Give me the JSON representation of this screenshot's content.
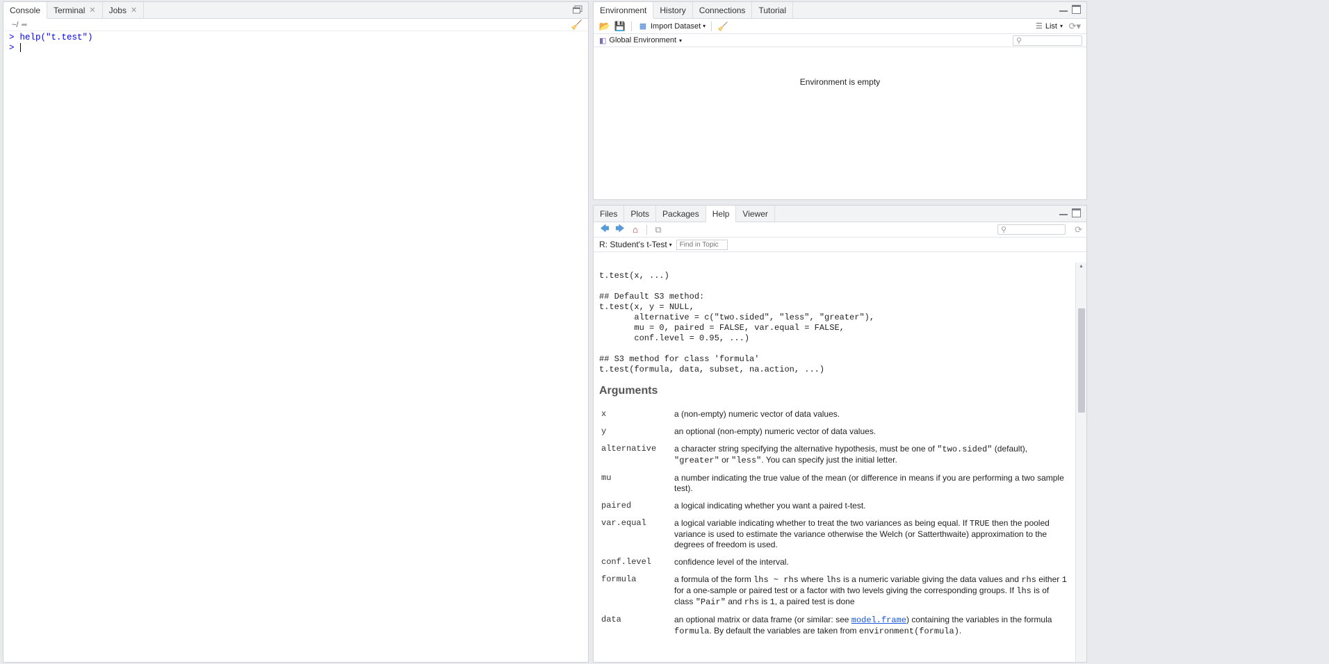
{
  "console_pane": {
    "tabs": [
      {
        "label": "Console",
        "closable": false,
        "active": true
      },
      {
        "label": "Terminal",
        "closable": true,
        "active": false
      },
      {
        "label": "Jobs",
        "closable": true,
        "active": false
      }
    ],
    "path": "~/",
    "lines": [
      {
        "prompt": ">",
        "text": "help(\"t.test\")"
      },
      {
        "prompt": ">",
        "text": ""
      }
    ]
  },
  "env_pane": {
    "tabs": [
      {
        "label": "Environment",
        "active": true
      },
      {
        "label": "History",
        "active": false
      },
      {
        "label": "Connections",
        "active": false
      },
      {
        "label": "Tutorial",
        "active": false
      }
    ],
    "import_label": "Import Dataset",
    "view_mode": "List",
    "scope_label": "Global Environment",
    "empty_message": "Environment is empty"
  },
  "help_pane": {
    "tabs": [
      {
        "label": "Files",
        "active": false
      },
      {
        "label": "Plots",
        "active": false
      },
      {
        "label": "Packages",
        "active": false
      },
      {
        "label": "Help",
        "active": true
      },
      {
        "label": "Viewer",
        "active": false
      }
    ],
    "topic_label": "R: Student's t-Test",
    "find_placeholder": "Find in Topic",
    "usage_code": "t.test(x, ...)\n\n## Default S3 method:\nt.test(x, y = NULL,\n       alternative = c(\"two.sided\", \"less\", \"greater\"),\n       mu = 0, paired = FALSE, var.equal = FALSE,\n       conf.level = 0.95, ...)\n\n## S3 method for class 'formula'\nt.test(formula, data, subset, na.action, ...)",
    "arguments_heading": "Arguments",
    "arguments": [
      {
        "name": "x",
        "desc": "a (non-empty) numeric vector of data values."
      },
      {
        "name": "y",
        "desc": "an optional (non-empty) numeric vector of data values."
      },
      {
        "name": "alternative",
        "desc_parts": [
          "a character string specifying the alternative hypothesis, must be one of ",
          "\"two.sided\"",
          " (default), ",
          "\"greater\"",
          " or ",
          "\"less\"",
          ". You can specify just the initial letter."
        ]
      },
      {
        "name": "mu",
        "desc": "a number indicating the true value of the mean (or difference in means if you are performing a two sample test)."
      },
      {
        "name": "paired",
        "desc": "a logical indicating whether you want a paired t-test."
      },
      {
        "name": "var.equal",
        "desc_parts": [
          "a logical variable indicating whether to treat the two variances as being equal. If ",
          "TRUE",
          " then the pooled variance is used to estimate the variance otherwise the Welch (or Satterthwaite) approximation to the degrees of freedom is used."
        ]
      },
      {
        "name": "conf.level",
        "desc": "confidence level of the interval."
      },
      {
        "name": "formula",
        "desc_parts": [
          "a formula of the form ",
          "lhs ~ rhs",
          " where ",
          "lhs",
          " is a numeric variable giving the data values and ",
          "rhs",
          " either ",
          "1",
          " for a one-sample or paired test or a factor with two levels giving the corresponding groups. If ",
          "lhs",
          " is of class ",
          "\"Pair\"",
          " and ",
          "rhs",
          " is ",
          "1",
          ", a paired test is done"
        ]
      },
      {
        "name": "data",
        "desc_parts": [
          "an optional matrix or data frame (or similar: see ",
          "model.frame",
          ") containing the variables in the formula ",
          "formula",
          ". By default the variables are taken from ",
          "environment(formula)",
          "."
        ]
      }
    ]
  }
}
